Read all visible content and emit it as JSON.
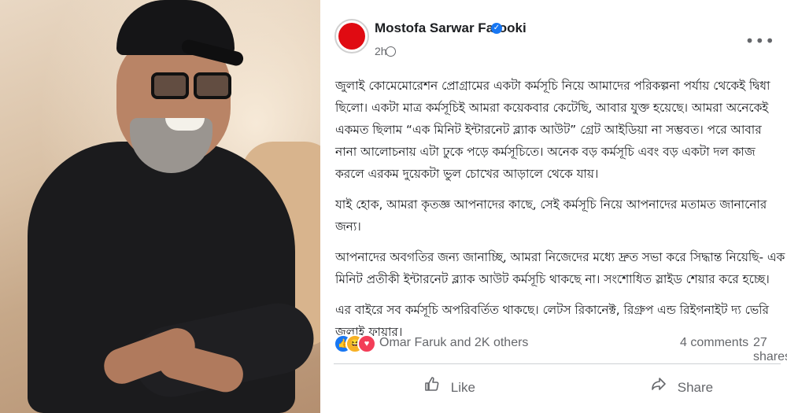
{
  "post": {
    "author": "Mostofa Sarwar Farooki",
    "time": "2h",
    "paragraphs": [
      "জুলাই কোমেমোরেশন প্রোগ্রামের একটা কর্মসূচি নিয়ে আমাদের পরিকল্পনা পর্যায় থেকেই দ্বিধা ছিলো। একটা মাত্র কর্মসূচিই আমরা কয়েকবার কেটেছি, আবার যুক্ত হয়েছে। আমরা অনেকেই একমত ছিলাম “এক মিনিট ইন্টারনেট ব্ল্যাক আউট” গ্রেট আইডিয়া না সম্ভবত। পরে আবার নানা আলোচনায় এটা ঢুকে পড়ে কর্মসূচিতে। অনেক বড় কর্মসূচি এবং বড় একটা দল কাজ করলে এরকম দুয়েকটা ভুল চোখের আড়ালে থেকে যায়।",
      "যাই হোক, আমরা কৃতজ্ঞ আপনাদের কাছে, সেই কর্মসূচি নিয়ে আপনাদের মতামত জানানোর জন্য।",
      "আপনাদের অবগতির জন্য জানাচ্ছি, আমরা নিজেদের মধ্যে দ্রুত সভা করে সিদ্ধান্ত নিয়েছি- এক মিনিট প্রতীকী ইন্টারনেট ব্ল্যাক আউট কর্মসূচি থাকছে না। সংশোধিত স্লাইড শেয়ার করে হচ্ছে।",
      "এর বাইরে সব কর্মসূচি অপরিবর্তিত থাকছে। লেটস রিকানেক্ট, রিগ্রুপ এন্ড রিইগনাইট দ্য ভেরি জুলাই ফায়ার।"
    ]
  },
  "reactions": {
    "names": "Omar Faruk and 2K others",
    "comments": "4 comments",
    "shares": "27 shares"
  },
  "actions": {
    "like": "Like",
    "share": "Share"
  },
  "icons": {
    "verified": "verified-badge-icon",
    "audience": "globe-icon",
    "menu": "more-options-icon",
    "like": "thumbs-up-icon",
    "share": "share-arrow-icon"
  },
  "colors": {
    "avatar": "#e00b12",
    "verified": "#1877f2",
    "muted_text": "#65676b",
    "body_text": "#1c1e21"
  }
}
